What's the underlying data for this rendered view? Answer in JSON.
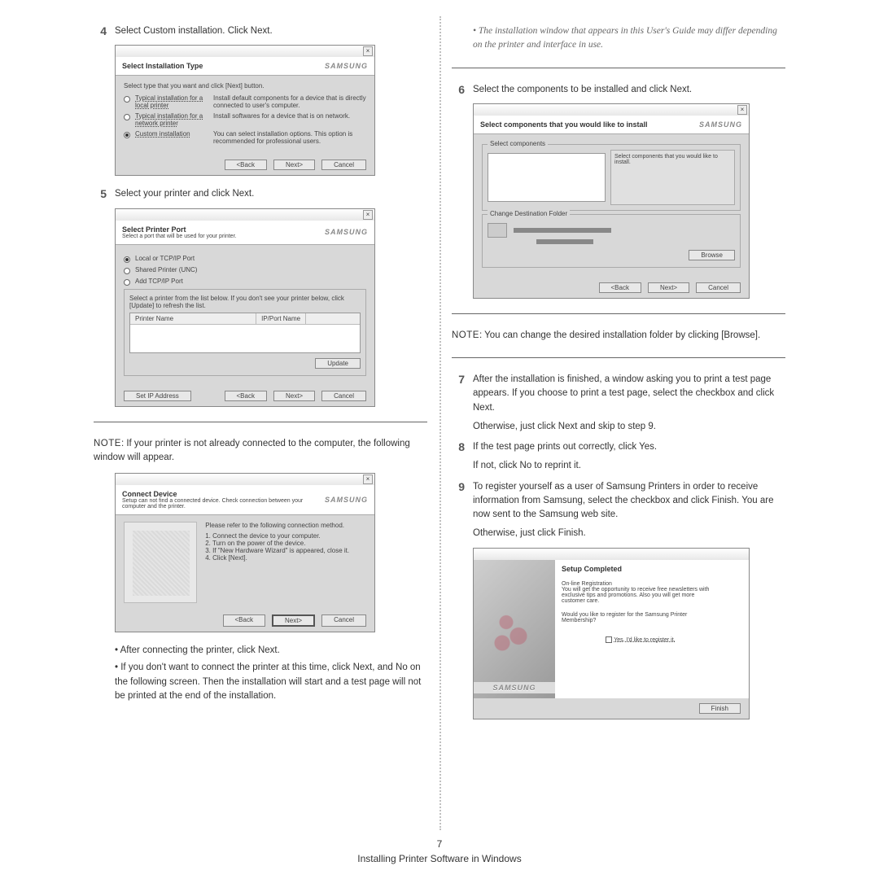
{
  "steps": {
    "s4": "Select Custom installation. Click Next.",
    "s5": "Select your printer and click Next.",
    "s6": "Select the components to be installed and click Next.",
    "s7": "After the installation is finished, a window asking you to print a test page appears. If you choose to print a test page, select the checkbox and click Next.",
    "s7b": "Otherwise, just click Next and skip to step 9.",
    "s8": "If the test page prints out correctly, click Yes.",
    "s8b": "If not, click No to reprint it.",
    "s9": "To register yourself as a user of Samsung Printers in order to receive information from Samsung, select the checkbox and click Finish. You are now sent to the Samsung web site.",
    "s9b": "Otherwise, just click Finish."
  },
  "note1_label": "NOTE",
  "note1": ": If your printer is not already connected to the computer, the following window will appear.",
  "note2_label": "NOTE",
  "note2": ": You can change the desired installation folder by clicking [Browse].",
  "bul1": "After connecting the printer, click Next.",
  "bul2": "If you don't want to connect the printer at this time, click Next, and No on the following screen. Then the installation will start and a test page will not be printed at the end of the installation.",
  "ital": "The installation window that appears in this User's Guide may differ depending on the printer and interface in use.",
  "d1": {
    "title": "Select Installation Type",
    "sub": "Select type that you want and click [Next] button.",
    "opt1": "Typical installation for a local printer",
    "opt1d": "Install default components for a device that is directly connected to user's computer.",
    "opt2": "Typical installation for a network printer",
    "opt2d": "Install softwares for a device that is on network.",
    "opt3": "Custom installation",
    "opt3d": "You can select installation options. This option is recommended for professional users."
  },
  "d2": {
    "title": "Select Printer Port",
    "sub": "Select a port that will be used for your printer.",
    "r1": "Local or TCP/IP Port",
    "r2": "Shared Printer (UNC)",
    "r3": "Add TCP/IP Port",
    "hint": "Select a printer from the list below. If you don't see your printer below, click [Update] to refresh the list.",
    "col1": "Printer Name",
    "col2": "IP/Port Name",
    "setip": "Set IP Address",
    "update": "Update"
  },
  "d3": {
    "title": "Connect Device",
    "sub": "Setup can not find a connected device. Check connection between your computer and the printer.",
    "p0": "Please refer to the following connection method.",
    "p1": "1. Connect the device to your computer.",
    "p2": "2. Turn on the power of the device.",
    "p3": "3. If \"New Hardware Wizard\" is appeared, close it.",
    "p4": "4. Click [Next]."
  },
  "d4": {
    "title": "Select components that you would like to install",
    "g1": "Select components",
    "hint": "Select components that you would like to install.",
    "g2": "Change Destination Folder",
    "browse": "Browse"
  },
  "d5": {
    "title": "Setup Completed",
    "reg": "On-line Registration",
    "regtext": "You will get the opportunity to receive free newsletters with exclusive tips and promotions. Also you will get more customer care.",
    "q": "Would you like to register for the Samsung Printer Membership?",
    "chk": "Yes, I'd like to register it.",
    "finish": "Finish"
  },
  "btns": {
    "back": "<Back",
    "next": "Next>",
    "cancel": "Cancel"
  },
  "brand": "SAMSUNG",
  "footer": {
    "page": "7",
    "title": "Installing Printer Software in Windows"
  }
}
